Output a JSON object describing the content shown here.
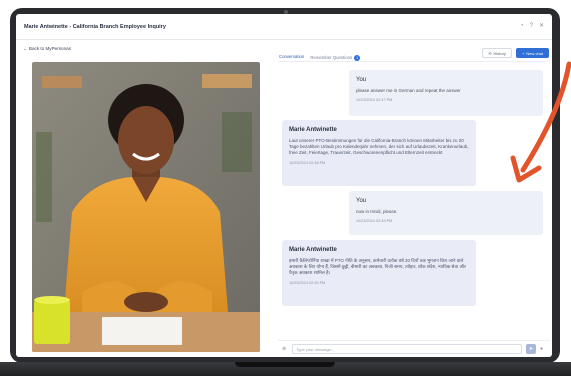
{
  "window": {
    "title": "Marie Antwinette - California Branch Employee Inquiry",
    "icons": [
      "history-circle-icon",
      "help-icon",
      "close-icon"
    ]
  },
  "left": {
    "back_link": "Back to MyPersonas"
  },
  "right": {
    "tabs": [
      {
        "label": "Conversation",
        "active": true
      },
      {
        "label": "Remember Questions",
        "badge": "1"
      }
    ],
    "history_label": "History",
    "new_chat_label": "New chat"
  },
  "messages": [
    {
      "sender": "You",
      "role": "user",
      "text": "please answer me in German and repeat the answer",
      "time": "10/23/2024 02:47 PM"
    },
    {
      "sender": "Marie Antwinette",
      "role": "agent",
      "text": "Laut unserer PTO-Bestimmungen für die California-Branch können Mitarbeiter bis zu 20 Tage bezahlten Urlaub pro Kalenderjahr nehmen, der sich auf Urlaubszeit, Krankenurlaub, freie Zeit, Feiertage, Trauerzeit, Geschworenenpflicht und Elternzeit erstreckt",
      "time": "10/23/2024 02:48 PM"
    },
    {
      "sender": "You",
      "role": "user",
      "text": "now in Hindi, please.",
      "time": "10/23/2024 02:49 PM"
    },
    {
      "sender": "Marie Antwinette",
      "role": "agent",
      "text": "हमारी कैलिफोर्निया शाखा में PTO नीति के अनुसार, कर्मचारी प्रत्येक वर्ष 20 दिनों तक भुगतान किए जाने वाले अवकाश के लिए योग्य हैं, जिसमें छुट्टी, बीमारी का अवकाश, निजी समय, त्योहार, शोक संदेश, न्यायिक सेवा और पैतृक अवकाश शामिल है।",
      "time": "10/23/2024 02:50 PM"
    }
  ],
  "input": {
    "placeholder": "Type your message..."
  },
  "colors": {
    "accent": "#2f6fd6",
    "arrow": "#e2552b",
    "frame": "#2a2b2e"
  }
}
